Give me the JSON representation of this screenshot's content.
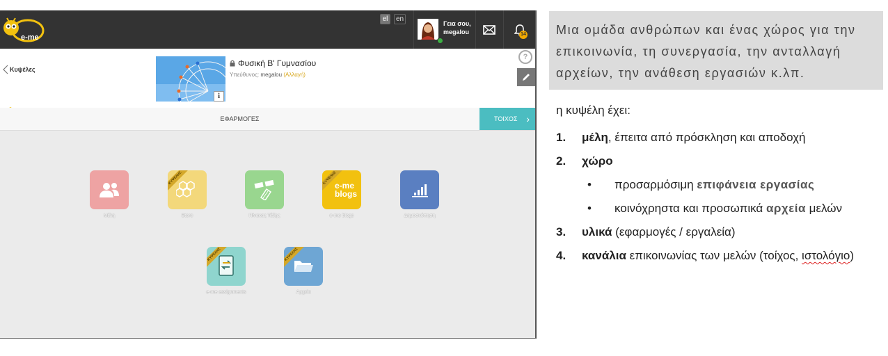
{
  "topbar": {
    "logo_text": "e-me",
    "languages": [
      "el",
      "en"
    ],
    "greeting": "Γεια σου,",
    "username": "megalou",
    "notification_count": "14"
  },
  "hive": {
    "back_label": "Κυψέλες",
    "title": "Φυσική Β' Γυμνασίου",
    "owner_label": "Υπεύθυνος:",
    "owner_name": "megalou",
    "change_label": "(Αλλαγή)",
    "info_label": "i",
    "help_label": "?"
  },
  "tabs": {
    "apps": "ΕΦΑΡΜΟΓΕΣ",
    "wall": "ΤΟΙΧΟΣ"
  },
  "ribbon_label": "ΚΥΨΕΛΗΣ",
  "apps": [
    {
      "label": "Μέλη",
      "color": "#eea3a3",
      "icon": "members-icon",
      "ribbon": false
    },
    {
      "label": "Store",
      "color": "#f3d87b",
      "icon": "honeycomb-icon",
      "ribbon": true
    },
    {
      "label": "Πίνακας Τάξης",
      "color": "#99d68f",
      "icon": "class-board-icon",
      "ribbon": false
    },
    {
      "label": "e-me blogs",
      "color": "#f2c10f",
      "icon": "blogs-icon",
      "ribbon": true,
      "tile_text": [
        "e-me",
        "blogs"
      ]
    },
    {
      "label": "Δημοσκόπηση",
      "color": "#5a7fc1",
      "icon": "bar-chart-icon",
      "ribbon": false
    },
    {
      "label": "e-me assignments",
      "color": "#8fd5ce",
      "icon": "assignments-icon",
      "ribbon": true
    },
    {
      "label": "Αρχεία",
      "color": "#6ea6d4",
      "icon": "folder-icon",
      "ribbon": true
    }
  ],
  "description": "Μια ομάδα ανθρώπων και ένας χώρος για την επικοινωνία, τη συνεργασία, την ανταλλαγή αρχείων, την ανάθεση εργασιών κ.λπ.",
  "intro": "η κυψέλη έχει:",
  "list": {
    "i1": {
      "num": "1.",
      "bold": "μέλη",
      "rest": ", έπειτα από πρόσκληση και αποδοχή"
    },
    "i2": {
      "num": "2.",
      "bold": "χώρο"
    },
    "s1": {
      "bullet": "•",
      "pre": "προσαρμόσιμη ",
      "hl": "επιφάνεια εργασίας"
    },
    "s2": {
      "bullet": "•",
      "pre": "κοινόχρηστα και προσωπικά ",
      "hl": "αρχεία",
      "post": " μελών"
    },
    "i3": {
      "num": "3.",
      "bold": "υλικά",
      "rest": " (εφαρμογές / εργαλεία)"
    },
    "i4": {
      "num": "4.",
      "bold": "κανάλια",
      "rest": " επικοινωνίας των μελών (τοίχος, ",
      "wavy": "ιστολόγιο",
      "tail": ")"
    }
  }
}
